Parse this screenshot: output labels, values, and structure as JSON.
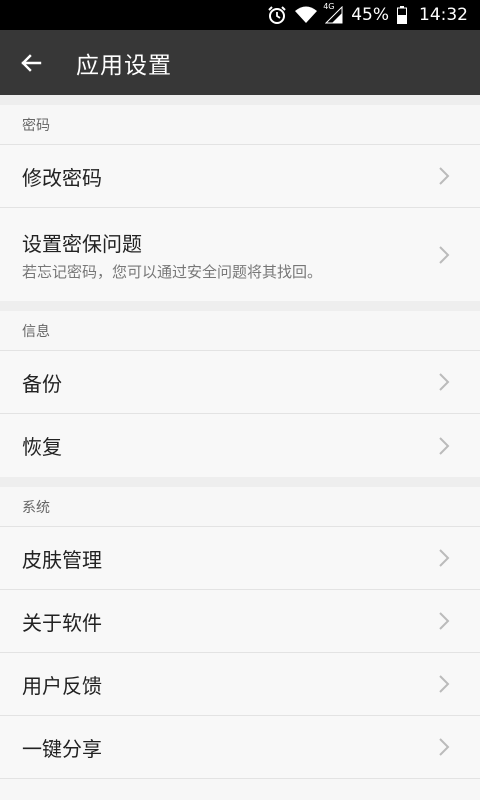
{
  "status_bar": {
    "network": "4G",
    "battery": "45%",
    "time": "14:32",
    "icons": [
      "alarm-icon",
      "wifi-icon",
      "cell-signal-icon",
      "battery-icon"
    ]
  },
  "app_bar": {
    "title": "应用设置",
    "back_icon": "arrow-left-icon",
    "background": "#373737"
  },
  "sections": [
    {
      "header": "密码",
      "items": [
        {
          "label": "修改密码"
        },
        {
          "label": "设置密保问题",
          "subtitle": "若忘记密码，您可以通过安全问题将其找回。"
        }
      ]
    },
    {
      "header": "信息",
      "items": [
        {
          "label": "备份"
        },
        {
          "label": "恢复"
        }
      ]
    },
    {
      "header": "系统",
      "items": [
        {
          "label": "皮肤管理"
        },
        {
          "label": "关于软件"
        },
        {
          "label": "用户反馈"
        },
        {
          "label": "一键分享"
        }
      ]
    }
  ]
}
